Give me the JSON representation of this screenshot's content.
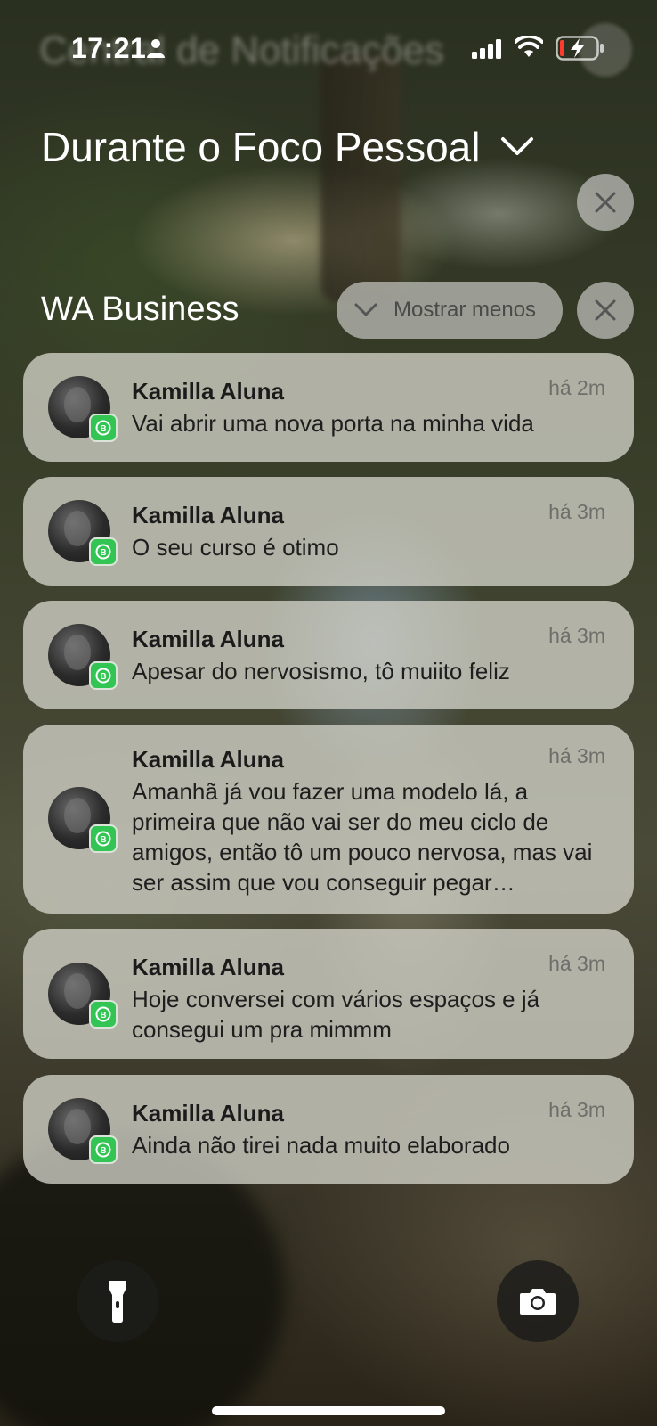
{
  "status_bar": {
    "time": "17:21",
    "ghost_title": "Central de Notificações"
  },
  "focus": {
    "title": "Durante o Foco Pessoal"
  },
  "group": {
    "app_name": "WA Business",
    "show_less_label": "Mostrar menos"
  },
  "notifications": [
    {
      "sender": "Kamilla Aluna",
      "time": "há 2m",
      "message": "Vai abrir uma nova porta na minha vida"
    },
    {
      "sender": "Kamilla Aluna",
      "time": "há 3m",
      "message": "O seu curso é otimo"
    },
    {
      "sender": "Kamilla Aluna",
      "time": "há 3m",
      "message": "Apesar do nervosismo, tô muiito feliz"
    },
    {
      "sender": "Kamilla Aluna",
      "time": "há 3m",
      "message": "Amanhã já vou fazer uma modelo lá, a primeira que não vai ser do meu ciclo de amigos, então tô um pouco nervosa, mas vai ser assim que vou conseguir pegar…"
    },
    {
      "sender": "Kamilla Aluna",
      "time": "há 3m",
      "message": "Hoje conversei com vários espaços e já consegui um pra mimmm"
    },
    {
      "sender": "Kamilla Aluna",
      "time": "há 3m",
      "message": "Ainda não tirei nada muito elaborado"
    }
  ],
  "icons": {
    "flashlight": "flashlight-icon",
    "camera": "camera-icon",
    "close": "close-icon",
    "app_badge": "whatsapp-business-icon"
  },
  "colors": {
    "whatsapp_green": "#33c553",
    "card_bg": "#d2d2c8"
  }
}
